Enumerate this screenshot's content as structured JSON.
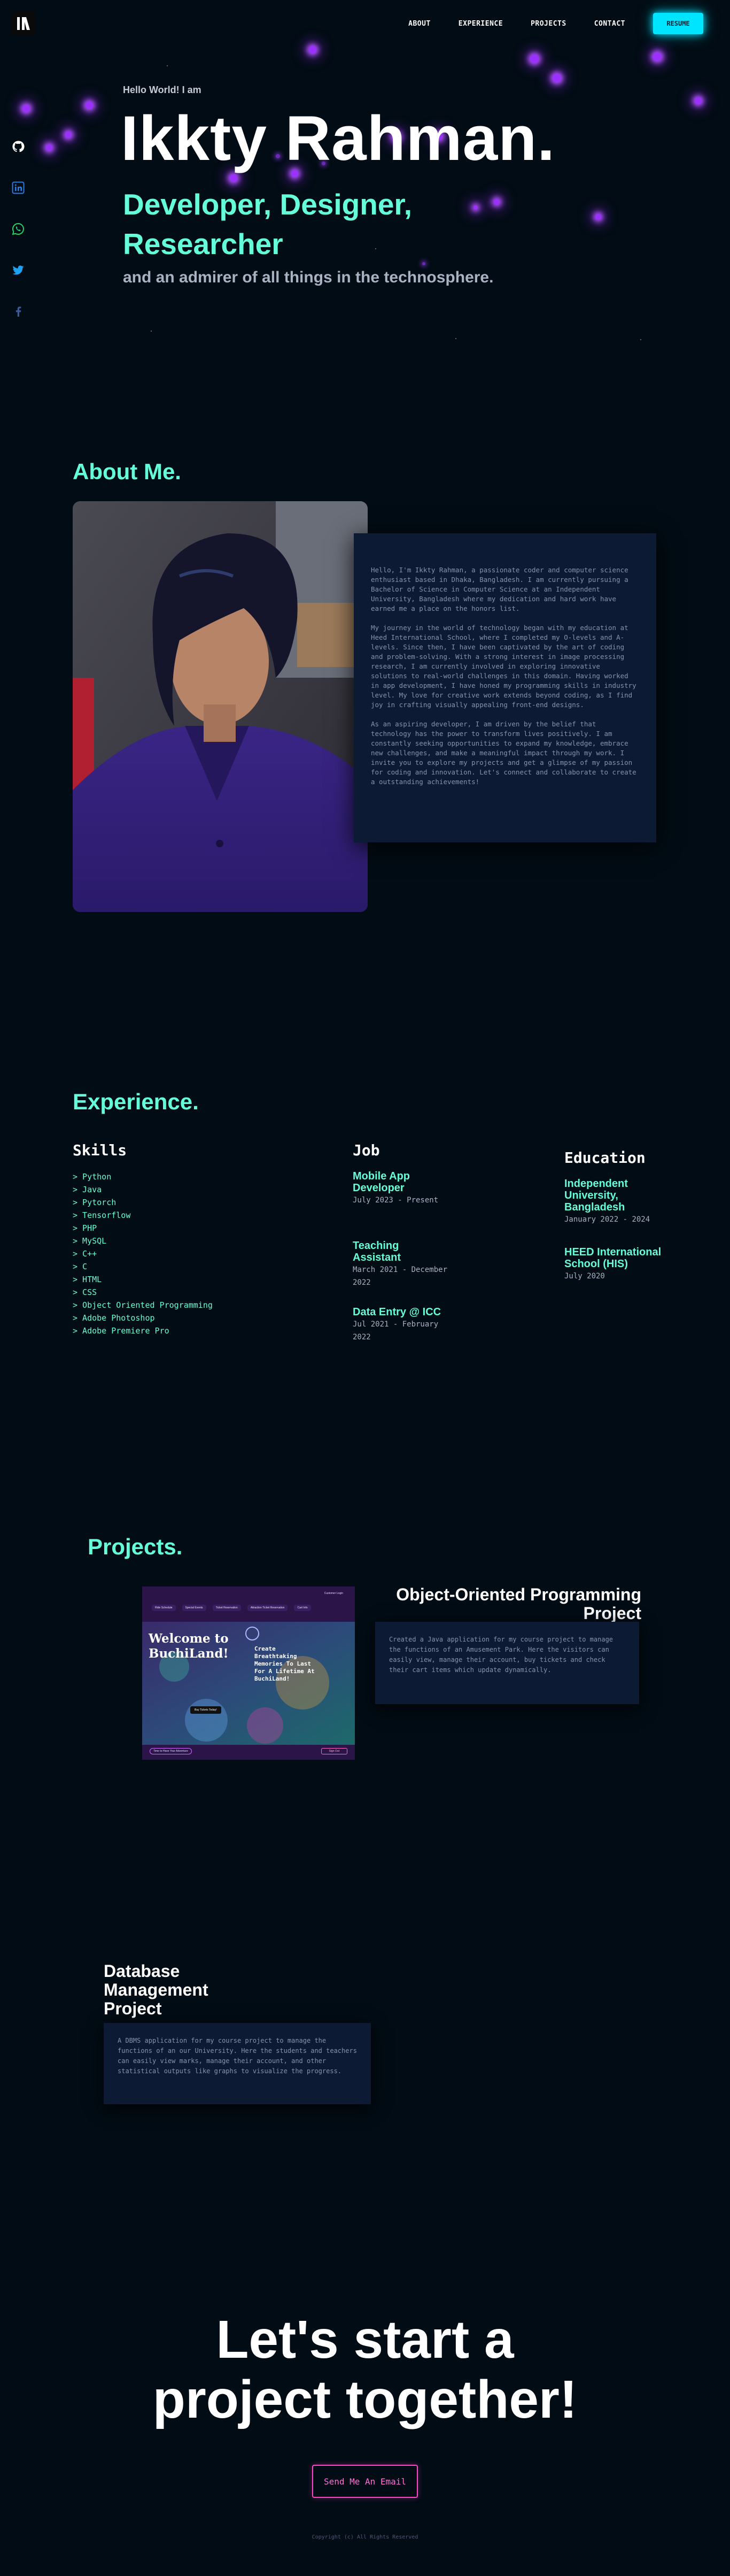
{
  "nav": {
    "logo_alt": "IR",
    "links": [
      {
        "label": "ABOUT"
      },
      {
        "label": "EXPERIENCE"
      },
      {
        "label": "PROJECTS"
      },
      {
        "label": "CONTACT"
      }
    ],
    "resume_label": "RESUME"
  },
  "hero": {
    "hello": "Hello World! I am",
    "name": "Ikkty Rahman.",
    "role": "Developer, Designer, Researcher",
    "subtitle": "and an admirer of all things in the technosphere."
  },
  "social": [
    {
      "icon": "github-icon",
      "color": "#ffffff"
    },
    {
      "icon": "linkedin-icon",
      "color": "#2b7de0"
    },
    {
      "icon": "whatsapp-icon",
      "color": "#25d366"
    },
    {
      "icon": "twitter-icon",
      "color": "#1da1f2"
    },
    {
      "icon": "facebook-icon",
      "color": "#3b5998"
    }
  ],
  "about": {
    "title": "About Me.",
    "paragraphs": [
      "Hello, I'm Ikkty Rahman, a passionate coder and computer science enthusiast based in Dhaka, Bangladesh. I am currently pursuing a Bachelor of Science in Computer Science at an Independent University, Bangladesh where my dedication and hard work have earned me a place on the honors list.",
      "My journey in the world of technology began with my education at Heed International School, where I completed my O-levels and A-levels. Since then, I have been captivated by the art of coding and problem-solving. With a strong interest in image processing research, I am currently involved in exploring innovative solutions to real-world challenges in this domain. Having worked in app development, I have honed my programming skills in industry level. My love for creative work extends beyond coding, as I find joy in crafting visually appealing front-end designs.",
      "As an aspiring developer, I am driven by the belief that technology has the power to transform lives positively. I am constantly seeking opportunities to expand my knowledge, embrace new challenges, and make a meaningful impact through my work. I invite you to explore my projects and get a glimpse of my passion for coding and innovation. Let's connect and collaborate to create a outstanding achievements!"
    ]
  },
  "experience": {
    "title": "Experience.",
    "skills_title": "Skills",
    "skills": [
      "> Python",
      "> Java",
      "> Pytorch",
      "> Tensorflow",
      "> PHP",
      "> MySQL",
      "> C++",
      "> C",
      "> HTML",
      "> CSS",
      "> Object Oriented Programming",
      "> Adobe Photoshop",
      "> Adobe Premiere Pro"
    ],
    "job_title": "Job",
    "jobs": [
      {
        "title": "Mobile App Developer",
        "date": "July 2023 - Present"
      },
      {
        "title": "Teaching Assistant",
        "date": "March 2021 - December 2022"
      },
      {
        "title": "Data Entry @ ICC",
        "date": "Jul 2021 - February 2022"
      }
    ],
    "education_title": "Education",
    "education": [
      {
        "title": "Independent University, Bangladesh",
        "date": "January 2022 - 2024"
      },
      {
        "title": "HEED International School (HIS)",
        "date": "July 2020"
      }
    ]
  },
  "projects": {
    "title": "Projects.",
    "items": [
      {
        "title": "Object-Oriented Programming Project",
        "description": "Created a Java application for my course project to manage the functions of an Amusement Park. Here the visitors can easily view, manage their account, buy tickets and check their cart items which update dynamically."
      },
      {
        "title": "Database Management Project",
        "description": "A DBMS application for my course project to manage the functions of an our University. Here the students and teachers can easily view marks, manage their account, and other statistical outputs like graphs to visualize the progress."
      }
    ],
    "screenshot": {
      "nav_items": [
        "Ride Schedule",
        "Special Events",
        "Ticket Reservation",
        "Attraction Ticket Reservation",
        "Cart Info"
      ],
      "login": "Customer Login",
      "welcome": "Welcome to BuchiLand!",
      "tagline": "Create Breathtaking Memories To Last For A Lifetime At BuchiLand!",
      "button": "Buy Tickets Today!",
      "footer_left": "Time to Have Your Adventure",
      "footer_right": "Sign Out"
    }
  },
  "contact": {
    "cta": "Let's start a project together!",
    "email_label": "Send Me An Email",
    "copyright": "Copyright (c) All Rights Reserved"
  },
  "colors": {
    "accent": "#64ffda",
    "neon": "#00e5ff",
    "glow": "#9b30ff",
    "card": "#0c1b33",
    "background": "#020c14",
    "email": "#ff46c8"
  }
}
